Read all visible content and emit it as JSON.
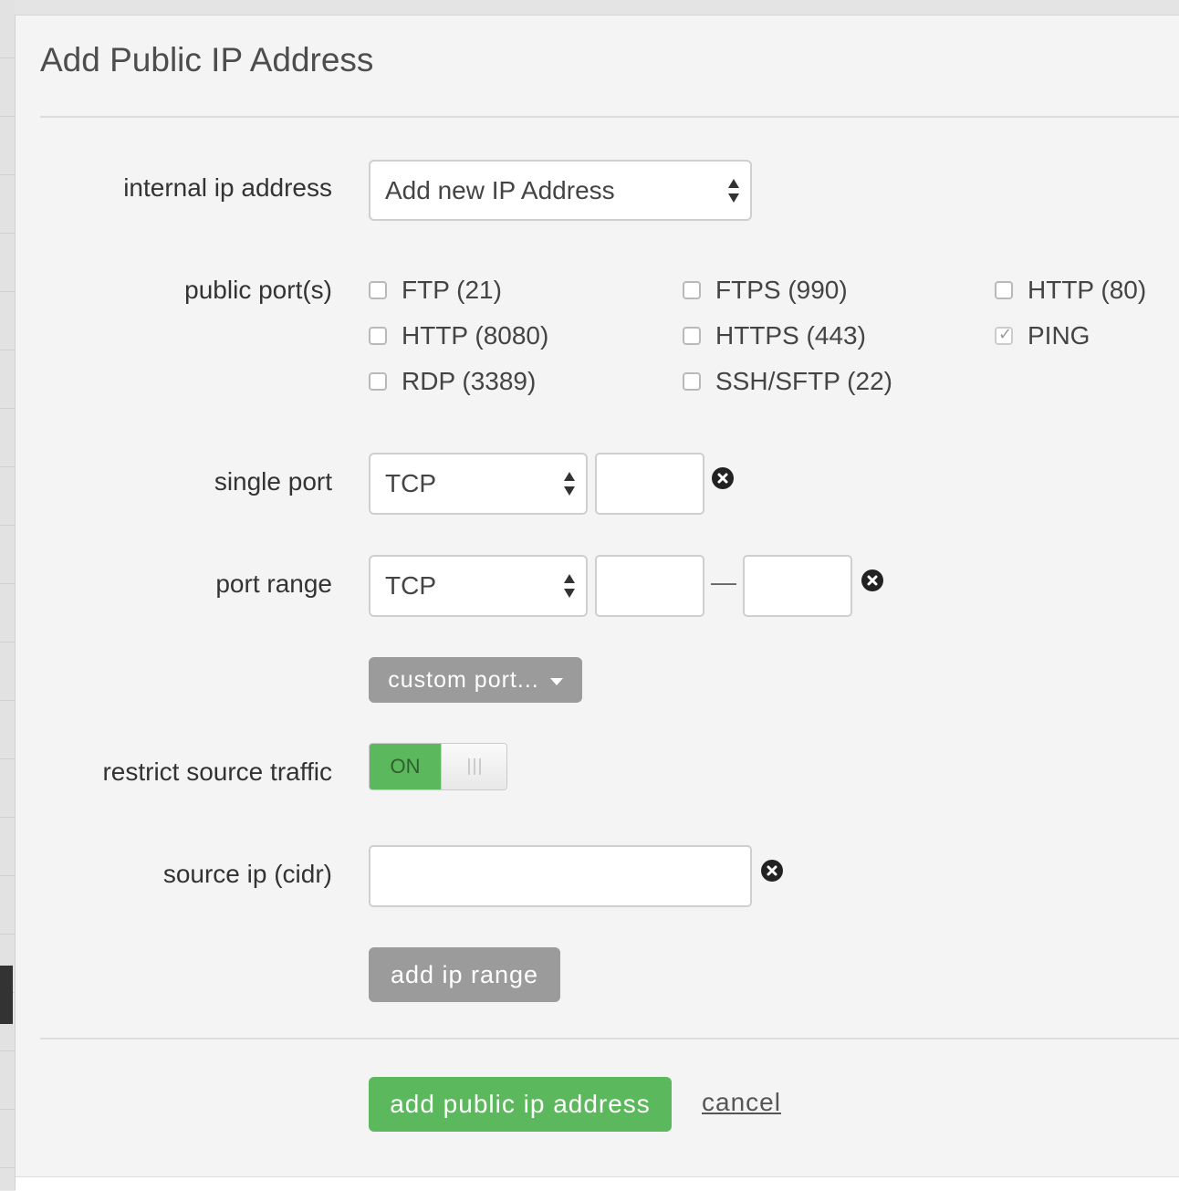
{
  "dialog": {
    "title": "Add Public IP Address"
  },
  "fields": {
    "internal_ip": {
      "label": "internal ip address",
      "selected": "Add new IP Address"
    },
    "public_ports": {
      "label": "public port(s)",
      "options": [
        {
          "label": "FTP (21)",
          "checked": false
        },
        {
          "label": "FTPS (990)",
          "checked": false
        },
        {
          "label": "HTTP (80)",
          "checked": false
        },
        {
          "label": "HTTP (8080)",
          "checked": false
        },
        {
          "label": "HTTPS (443)",
          "checked": false
        },
        {
          "label": "PING",
          "checked": true
        },
        {
          "label": "RDP (3389)",
          "checked": false
        },
        {
          "label": "SSH/SFTP (22)",
          "checked": false
        }
      ]
    },
    "single_port": {
      "label": "single port",
      "protocol": "TCP",
      "value": ""
    },
    "port_range": {
      "label": "port range",
      "protocol": "TCP",
      "from": "",
      "separator": "—",
      "to": ""
    },
    "custom_port": {
      "label": "custom port..."
    },
    "restrict_source": {
      "label": "restrict source traffic",
      "state": "ON"
    },
    "source_ip": {
      "label": "source ip (cidr)",
      "value": ""
    },
    "add_ip_range": {
      "label": "add ip range"
    }
  },
  "footer": {
    "submit_label": "add public ip address",
    "cancel_label": "cancel"
  },
  "colors": {
    "accent_green": "#5cb85c",
    "button_gray": "#9b9b9b",
    "panel_bg": "#f4f4f4"
  }
}
